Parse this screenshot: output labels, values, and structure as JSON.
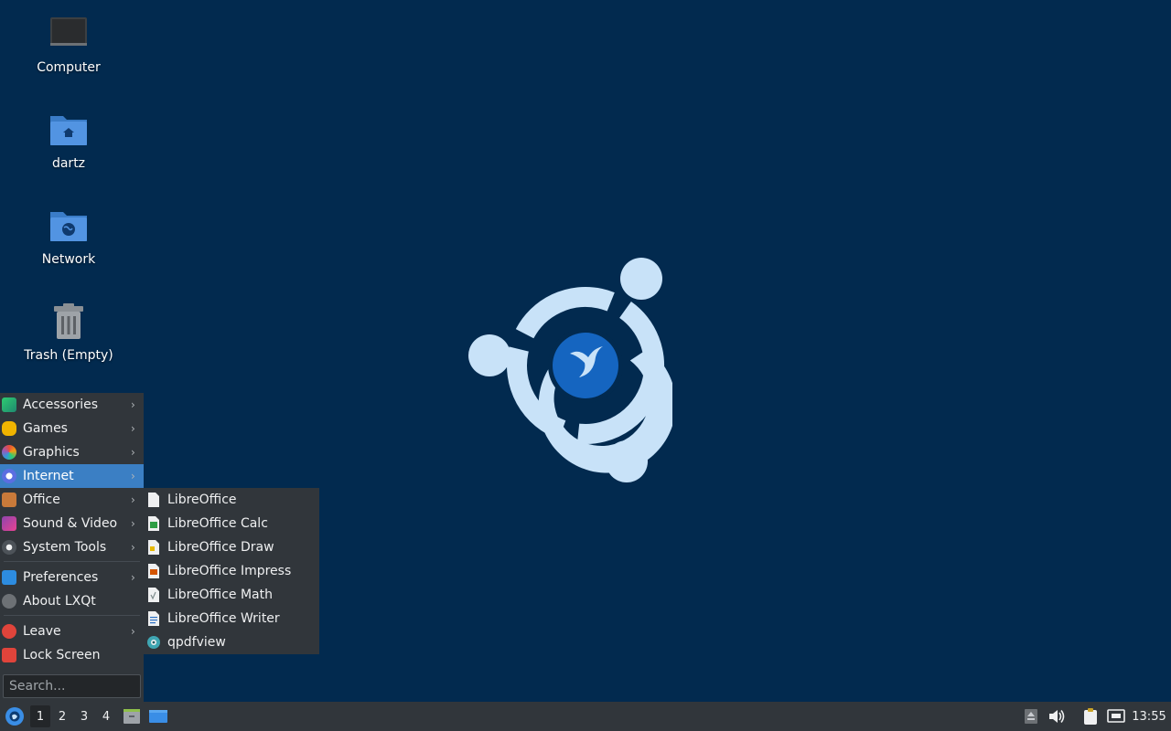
{
  "desktop": {
    "icons": [
      {
        "label": "Computer"
      },
      {
        "label": "dartz"
      },
      {
        "label": "Network"
      },
      {
        "label": "Trash (Empty)"
      }
    ]
  },
  "menu": {
    "items": [
      {
        "label": "Accessories",
        "icon": "accessories-icon"
      },
      {
        "label": "Games",
        "icon": "games-icon"
      },
      {
        "label": "Graphics",
        "icon": "graphics-icon"
      },
      {
        "label": "Internet",
        "icon": "internet-icon"
      },
      {
        "label": "Office",
        "icon": "office-icon"
      },
      {
        "label": "Sound & Video",
        "icon": "sound-video-icon"
      },
      {
        "label": "System Tools",
        "icon": "system-tools-icon"
      },
      {
        "label": "Preferences",
        "icon": "preferences-icon"
      },
      {
        "label": "About LXQt",
        "icon": "info-icon"
      },
      {
        "label": "Leave",
        "icon": "power-icon"
      },
      {
        "label": "Lock Screen",
        "icon": "lock-icon"
      }
    ],
    "active_item": "Internet",
    "search_placeholder": "Search..."
  },
  "submenu": {
    "items": [
      {
        "label": "LibreOffice",
        "icon": "libreoffice-icon"
      },
      {
        "label": "LibreOffice Calc",
        "icon": "calc-icon"
      },
      {
        "label": "LibreOffice Draw",
        "icon": "draw-icon"
      },
      {
        "label": "LibreOffice Impress",
        "icon": "impress-icon"
      },
      {
        "label": "LibreOffice Math",
        "icon": "math-icon"
      },
      {
        "label": "LibreOffice Writer",
        "icon": "writer-icon"
      },
      {
        "label": "qpdfview",
        "icon": "qpdfview-icon"
      }
    ]
  },
  "taskbar": {
    "workspaces": [
      "1",
      "2",
      "3",
      "4"
    ],
    "current_workspace": "1",
    "clock": "13:55"
  },
  "colors": {
    "desktop_bg": "#022a4f",
    "menu_bg": "#31363b",
    "highlight": "#3b7fc4",
    "logo_light": "#c8e2f8",
    "logo_blue": "#1565c0"
  }
}
